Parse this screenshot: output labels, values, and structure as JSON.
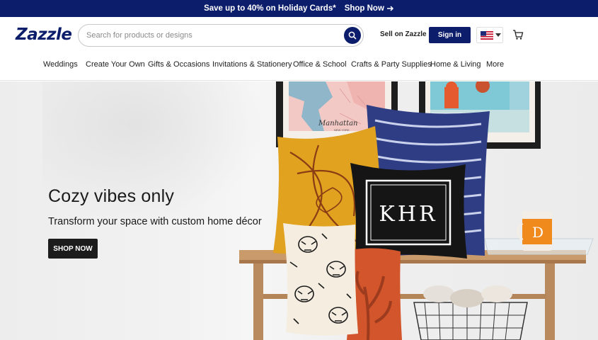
{
  "promo": {
    "text": "Save up to 40% on Holiday Cards*",
    "link_label": "Shop Now",
    "link_icon": "arrow-right-icon"
  },
  "header": {
    "logo_text": "Zazzle",
    "search_placeholder": "Search for products or designs",
    "search_value": "",
    "search_icon": "search-icon",
    "sell_label": "Sell on Zazzle",
    "signin_label": "Sign in",
    "locale_icon": "us-flag-icon",
    "cart_icon": "cart-icon"
  },
  "nav": {
    "items": [
      {
        "label": "Weddings"
      },
      {
        "label": "Create Your Own"
      },
      {
        "label": "Gifts & Occasions"
      },
      {
        "label": "Invitations & Stationery"
      },
      {
        "label": "Office & School"
      },
      {
        "label": "Crafts & Party Supplies"
      },
      {
        "label": "Home & Living"
      },
      {
        "label": "More"
      }
    ]
  },
  "hero": {
    "title": "Cozy vibes only",
    "subtitle": "Transform your space with custom home décor",
    "cta_label": "SHOP NOW",
    "pillow_monogram": "KHR",
    "mug_letter": "D",
    "print_city": "Manhattan",
    "print_caption": "NEW YORK"
  },
  "colors": {
    "brand_navy": "#0b1d6b",
    "cta_black": "#1c1c1c",
    "mustard": "#e0a21f",
    "rust": "#d2552b"
  }
}
